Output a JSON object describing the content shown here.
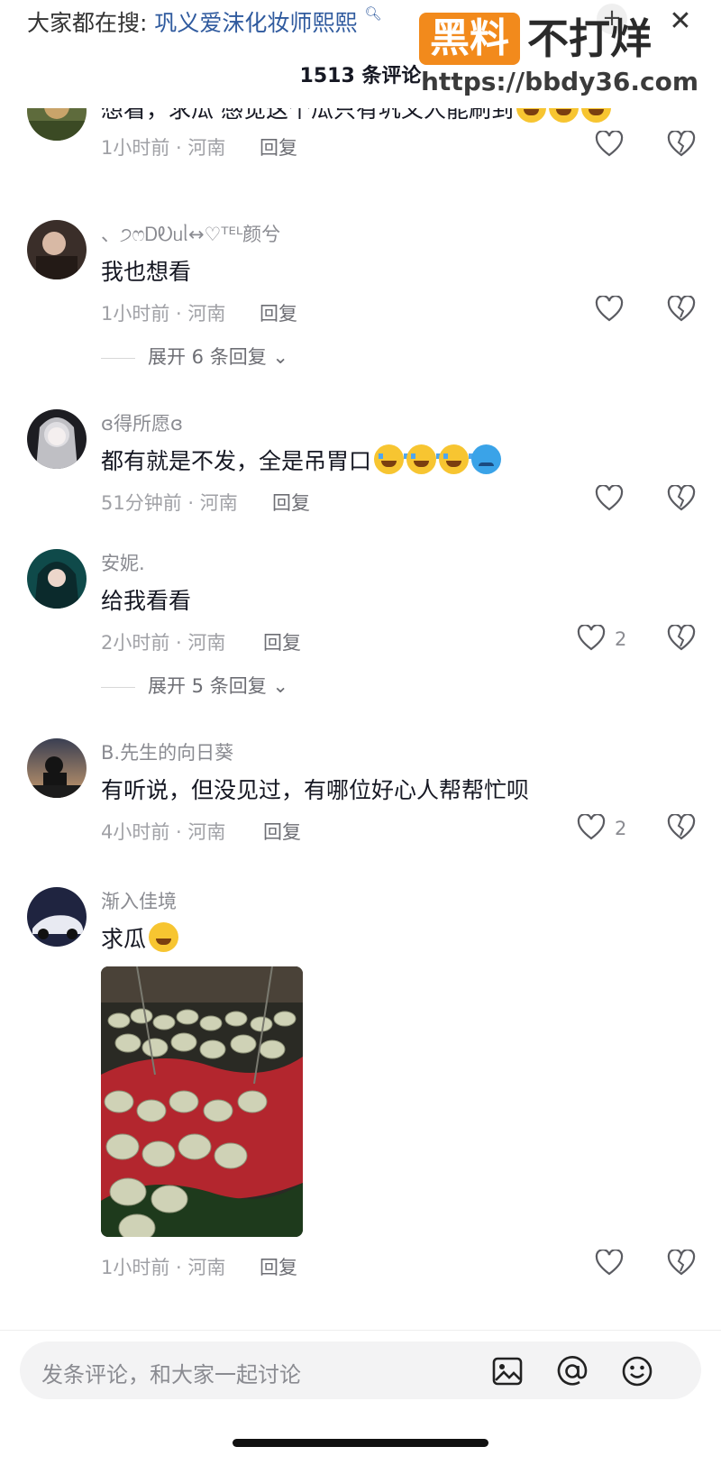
{
  "header": {
    "search_prefix": "大家都在搜:",
    "search_keyword": "巩义爱沫化妆师熙熙",
    "comment_count": "1513 条评论",
    "plus_symbol": "+",
    "close_symbol": "✕"
  },
  "watermark": {
    "badge": "黑料",
    "text": "不打烊",
    "url": "https://bbdy36.com"
  },
  "comments": [
    {
      "text": "想看，求瓜 感觉这个瓜只有巩义人能刷到",
      "emojis": [
        "laugh-cry",
        "laugh-cry",
        "laugh-cry"
      ],
      "meta": "1小时前 · 河南",
      "reply": "回复"
    },
    {
      "user": "、੭ෆᎠᎧᥙᥣ↔♡ᵀᴱᴸ颜兮",
      "text": "我也想看",
      "meta": "1小时前 · 河南",
      "reply": "回复",
      "expand": "展开 6 条回复"
    },
    {
      "user": "ɞ得所愿ɞ",
      "text": "都有就是不发，全是吊胃口",
      "emojis": [
        "cry",
        "cry",
        "cry",
        "sad"
      ],
      "meta": "51分钟前 · 河南",
      "reply": "回复"
    },
    {
      "user": "安妮.",
      "text": "给我看看",
      "meta": "2小时前 · 河南",
      "reply": "回复",
      "likes": "2",
      "expand": "展开 5 条回复"
    },
    {
      "user": "B.先生的向日葵",
      "text": "有听说，但没见过，有哪位好心人帮帮忙呗",
      "meta": "4小时前 · 河南",
      "reply": "回复",
      "likes": "2"
    },
    {
      "user": "渐入佳境",
      "text": "求瓜",
      "emojis": [
        "grin-sweat"
      ],
      "meta": "1小时前 · 河南",
      "reply": "回复"
    }
  ],
  "input": {
    "placeholder": "发条评论，和大家一起讨论",
    "icons": [
      "image-icon",
      "at-icon",
      "emoji-icon"
    ]
  },
  "colors": {
    "keyword": "#2f5a9e",
    "watermark_orange": "#f28a1c",
    "meta_gray": "#a0a1a6"
  }
}
